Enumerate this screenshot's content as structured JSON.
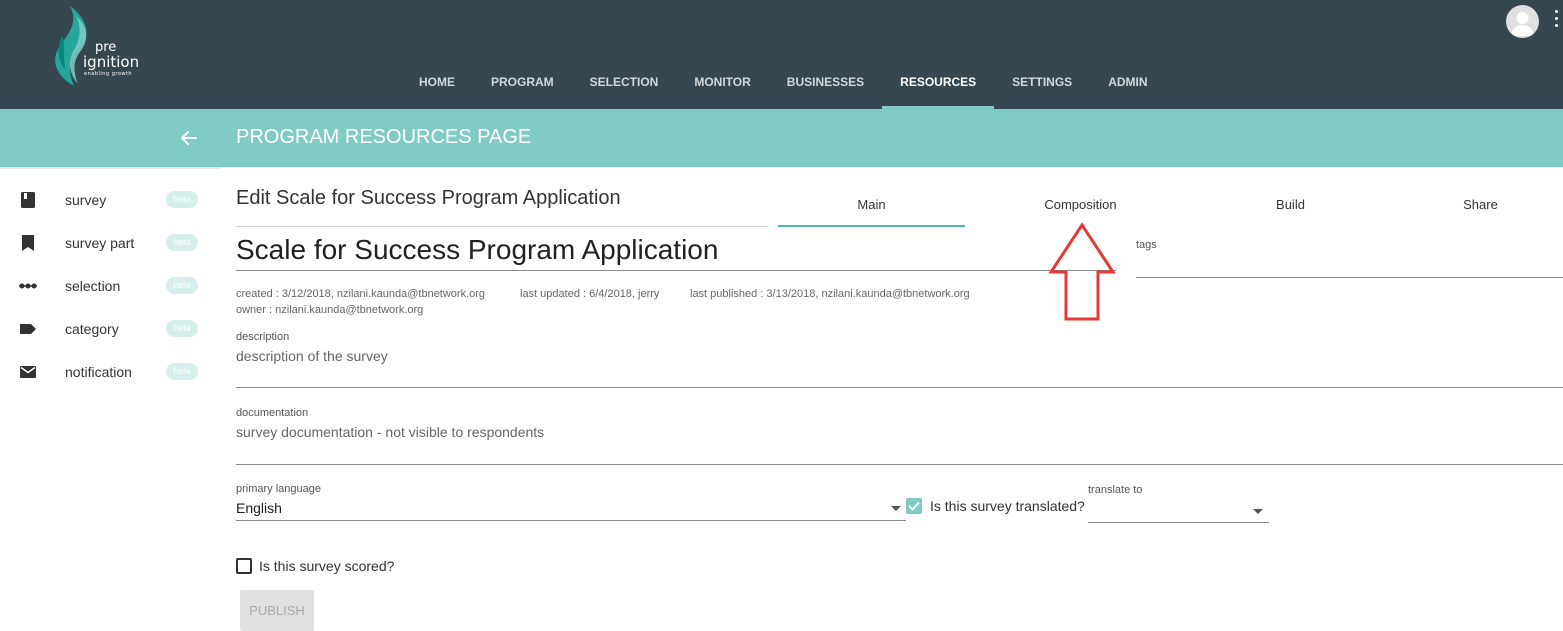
{
  "brand": {
    "pre": "pre",
    "ignition": "ignition",
    "tagline": "enabling growth"
  },
  "nav": {
    "items": [
      "HOME",
      "PROGRAM",
      "SELECTION",
      "MONITOR",
      "BUSINESSES",
      "RESOURCES",
      "SETTINGS",
      "ADMIN"
    ],
    "active": "RESOURCES"
  },
  "page": {
    "title": "PROGRAM RESOURCES PAGE"
  },
  "sidebar": {
    "items": [
      {
        "label": "survey",
        "icon": "book-icon",
        "badge": "beta"
      },
      {
        "label": "survey part",
        "icon": "bookmark-icon",
        "badge": "beta"
      },
      {
        "label": "selection",
        "icon": "dots-line-icon",
        "badge": "beta"
      },
      {
        "label": "category",
        "icon": "label-tag-icon",
        "badge": "beta"
      },
      {
        "label": "notification",
        "icon": "envelope-icon",
        "badge": "beta"
      }
    ]
  },
  "editor": {
    "heading": "Edit Scale for Success Program Application",
    "tabs": [
      "Main",
      "Composition",
      "Build",
      "Share"
    ],
    "active_tab": "Main",
    "survey_name": "Scale for Success Program Application",
    "tags_label": "tags",
    "meta": {
      "created": "created : 3/12/2018, nzilani.kaunda@tbnetwork.org",
      "last_updated": "last updated : 6/4/2018, jerry",
      "last_published": "last published : 3/13/2018, nzilani.kaunda@tbnetwork.org",
      "owner": "owner : nzilani.kaunda@tbnetwork.org"
    },
    "description": {
      "label": "description",
      "value": "description of the survey"
    },
    "documentation": {
      "label": "documentation",
      "value": "survey documentation - not visible to respondents"
    },
    "primary_language": {
      "label": "primary language",
      "value": "English"
    },
    "translated": {
      "label": "Is this survey translated?",
      "checked": true
    },
    "translate_to": {
      "label": "translate to",
      "value": ""
    },
    "scored": {
      "label": "Is this survey scored?",
      "checked": false
    },
    "publish_label": "PUBLISH"
  },
  "colors": {
    "topbar": "#37474f",
    "accent": "#80cbc4",
    "annotation": "#e53935"
  }
}
